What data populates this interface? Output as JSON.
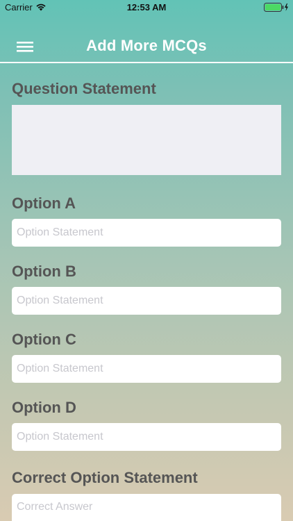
{
  "status_bar": {
    "carrier": "Carrier",
    "time": "12:53 AM",
    "wifi_icon": "wifi-icon",
    "battery_icon": "battery-charging-icon",
    "battery_color": "#4cd964"
  },
  "nav": {
    "title": "Add More MCQs",
    "menu_icon": "hamburger-menu-icon",
    "title_color": "#ffffff"
  },
  "form": {
    "question_label": "Question Statement",
    "question_value": "",
    "options": [
      {
        "label": "Option A",
        "placeholder": "Option Statement",
        "value": ""
      },
      {
        "label": "Option B",
        "placeholder": "Option Statement",
        "value": ""
      },
      {
        "label": "Option C",
        "placeholder": "Option Statement",
        "value": ""
      },
      {
        "label": "Option D",
        "placeholder": "Option Statement",
        "value": ""
      }
    ],
    "correct_label": "Correct Option Statement",
    "correct_placeholder": "Correct Answer"
  },
  "colors": {
    "gradient_top": "#62c3b6",
    "gradient_bottom": "#d9cbb2",
    "label_text": "#555555",
    "placeholder_text": "#c7c7cd"
  }
}
